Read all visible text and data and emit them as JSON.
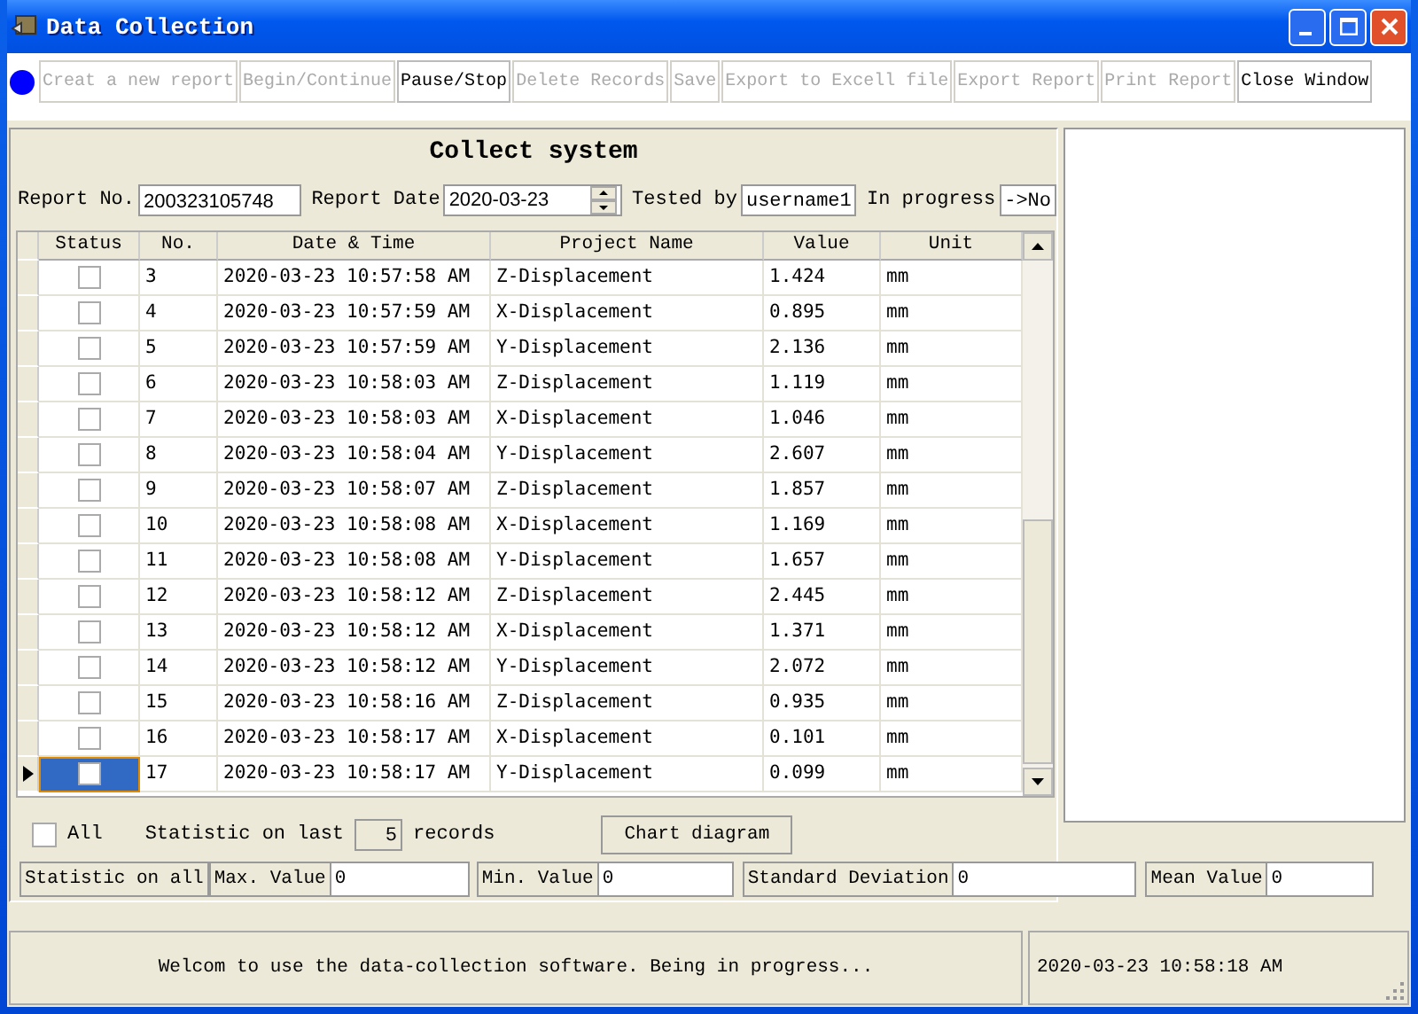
{
  "window": {
    "title": "Data Collection"
  },
  "toolbar": [
    {
      "label": "Creat a new report",
      "disabled": true
    },
    {
      "label": "Begin/Continue",
      "disabled": true
    },
    {
      "label": "Pause/Stop",
      "disabled": false
    },
    {
      "label": "Delete Records",
      "disabled": true
    },
    {
      "label": "Save",
      "disabled": true
    },
    {
      "label": "Export to Excell file",
      "disabled": true
    },
    {
      "label": "Export Report",
      "disabled": true
    },
    {
      "label": "Print Report",
      "disabled": true
    },
    {
      "label": "Close Window",
      "disabled": false
    }
  ],
  "heading": "Collect system",
  "report": {
    "no_label": "Report No.",
    "no": "200323105748",
    "date_label": "Report Date",
    "date": "2020-03-23",
    "tested_label": "Tested by",
    "tested": "username1",
    "progress_label": "In progress",
    "progress": "->No"
  },
  "table": {
    "columns": [
      "Status",
      "No.",
      "Date & Time",
      "Project Name",
      "Value",
      "Unit"
    ],
    "rows": [
      {
        "checked": false,
        "selected": false,
        "no": "3",
        "time": "2020-03-23 10:57:58 AM",
        "project": "Z-Displacement",
        "value": "1.424",
        "unit": "mm"
      },
      {
        "checked": false,
        "selected": false,
        "no": "4",
        "time": "2020-03-23 10:57:59 AM",
        "project": "X-Displacement",
        "value": "0.895",
        "unit": "mm"
      },
      {
        "checked": false,
        "selected": false,
        "no": "5",
        "time": "2020-03-23 10:57:59 AM",
        "project": "Y-Displacement",
        "value": "2.136",
        "unit": "mm"
      },
      {
        "checked": false,
        "selected": false,
        "no": "6",
        "time": "2020-03-23 10:58:03 AM",
        "project": "Z-Displacement",
        "value": "1.119",
        "unit": "mm"
      },
      {
        "checked": false,
        "selected": false,
        "no": "7",
        "time": "2020-03-23 10:58:03 AM",
        "project": "X-Displacement",
        "value": "1.046",
        "unit": "mm"
      },
      {
        "checked": false,
        "selected": false,
        "no": "8",
        "time": "2020-03-23 10:58:04 AM",
        "project": "Y-Displacement",
        "value": "2.607",
        "unit": "mm"
      },
      {
        "checked": false,
        "selected": false,
        "no": "9",
        "time": "2020-03-23 10:58:07 AM",
        "project": "Z-Displacement",
        "value": "1.857",
        "unit": "mm"
      },
      {
        "checked": false,
        "selected": false,
        "no": "10",
        "time": "2020-03-23 10:58:08 AM",
        "project": "X-Displacement",
        "value": "1.169",
        "unit": "mm"
      },
      {
        "checked": false,
        "selected": false,
        "no": "11",
        "time": "2020-03-23 10:58:08 AM",
        "project": "Y-Displacement",
        "value": "1.657",
        "unit": "mm"
      },
      {
        "checked": false,
        "selected": false,
        "no": "12",
        "time": "2020-03-23 10:58:12 AM",
        "project": "Z-Displacement",
        "value": "2.445",
        "unit": "mm"
      },
      {
        "checked": false,
        "selected": false,
        "no": "13",
        "time": "2020-03-23 10:58:12 AM",
        "project": "X-Displacement",
        "value": "1.371",
        "unit": "mm"
      },
      {
        "checked": false,
        "selected": false,
        "no": "14",
        "time": "2020-03-23 10:58:12 AM",
        "project": "Y-Displacement",
        "value": "2.072",
        "unit": "mm"
      },
      {
        "checked": false,
        "selected": false,
        "no": "15",
        "time": "2020-03-23 10:58:16 AM",
        "project": "Z-Displacement",
        "value": "0.935",
        "unit": "mm"
      },
      {
        "checked": false,
        "selected": false,
        "no": "16",
        "time": "2020-03-23 10:58:17 AM",
        "project": "X-Displacement",
        "value": "0.101",
        "unit": "mm"
      },
      {
        "checked": false,
        "selected": true,
        "no": "17",
        "time": "2020-03-23 10:58:17 AM",
        "project": "Y-Displacement",
        "value": "0.099",
        "unit": "mm"
      }
    ]
  },
  "statistics": {
    "all_label": "All",
    "all_checked": false,
    "last_label": "Statistic on last",
    "last_count": "5",
    "records_label": "records",
    "chart_button": "Chart diagram",
    "summary_label": "Statistic on all",
    "fields": [
      {
        "label": "Max. Value",
        "value": "0"
      },
      {
        "label": "Min. Value",
        "value": "0"
      },
      {
        "label": "Standard Deviation",
        "value": "0"
      },
      {
        "label": "Mean Value",
        "value": "0"
      }
    ]
  },
  "status_bar": {
    "message": "Welcom to use the data-collection software. Being in progress...",
    "time": "2020-03-23 10:58:18 AM"
  }
}
